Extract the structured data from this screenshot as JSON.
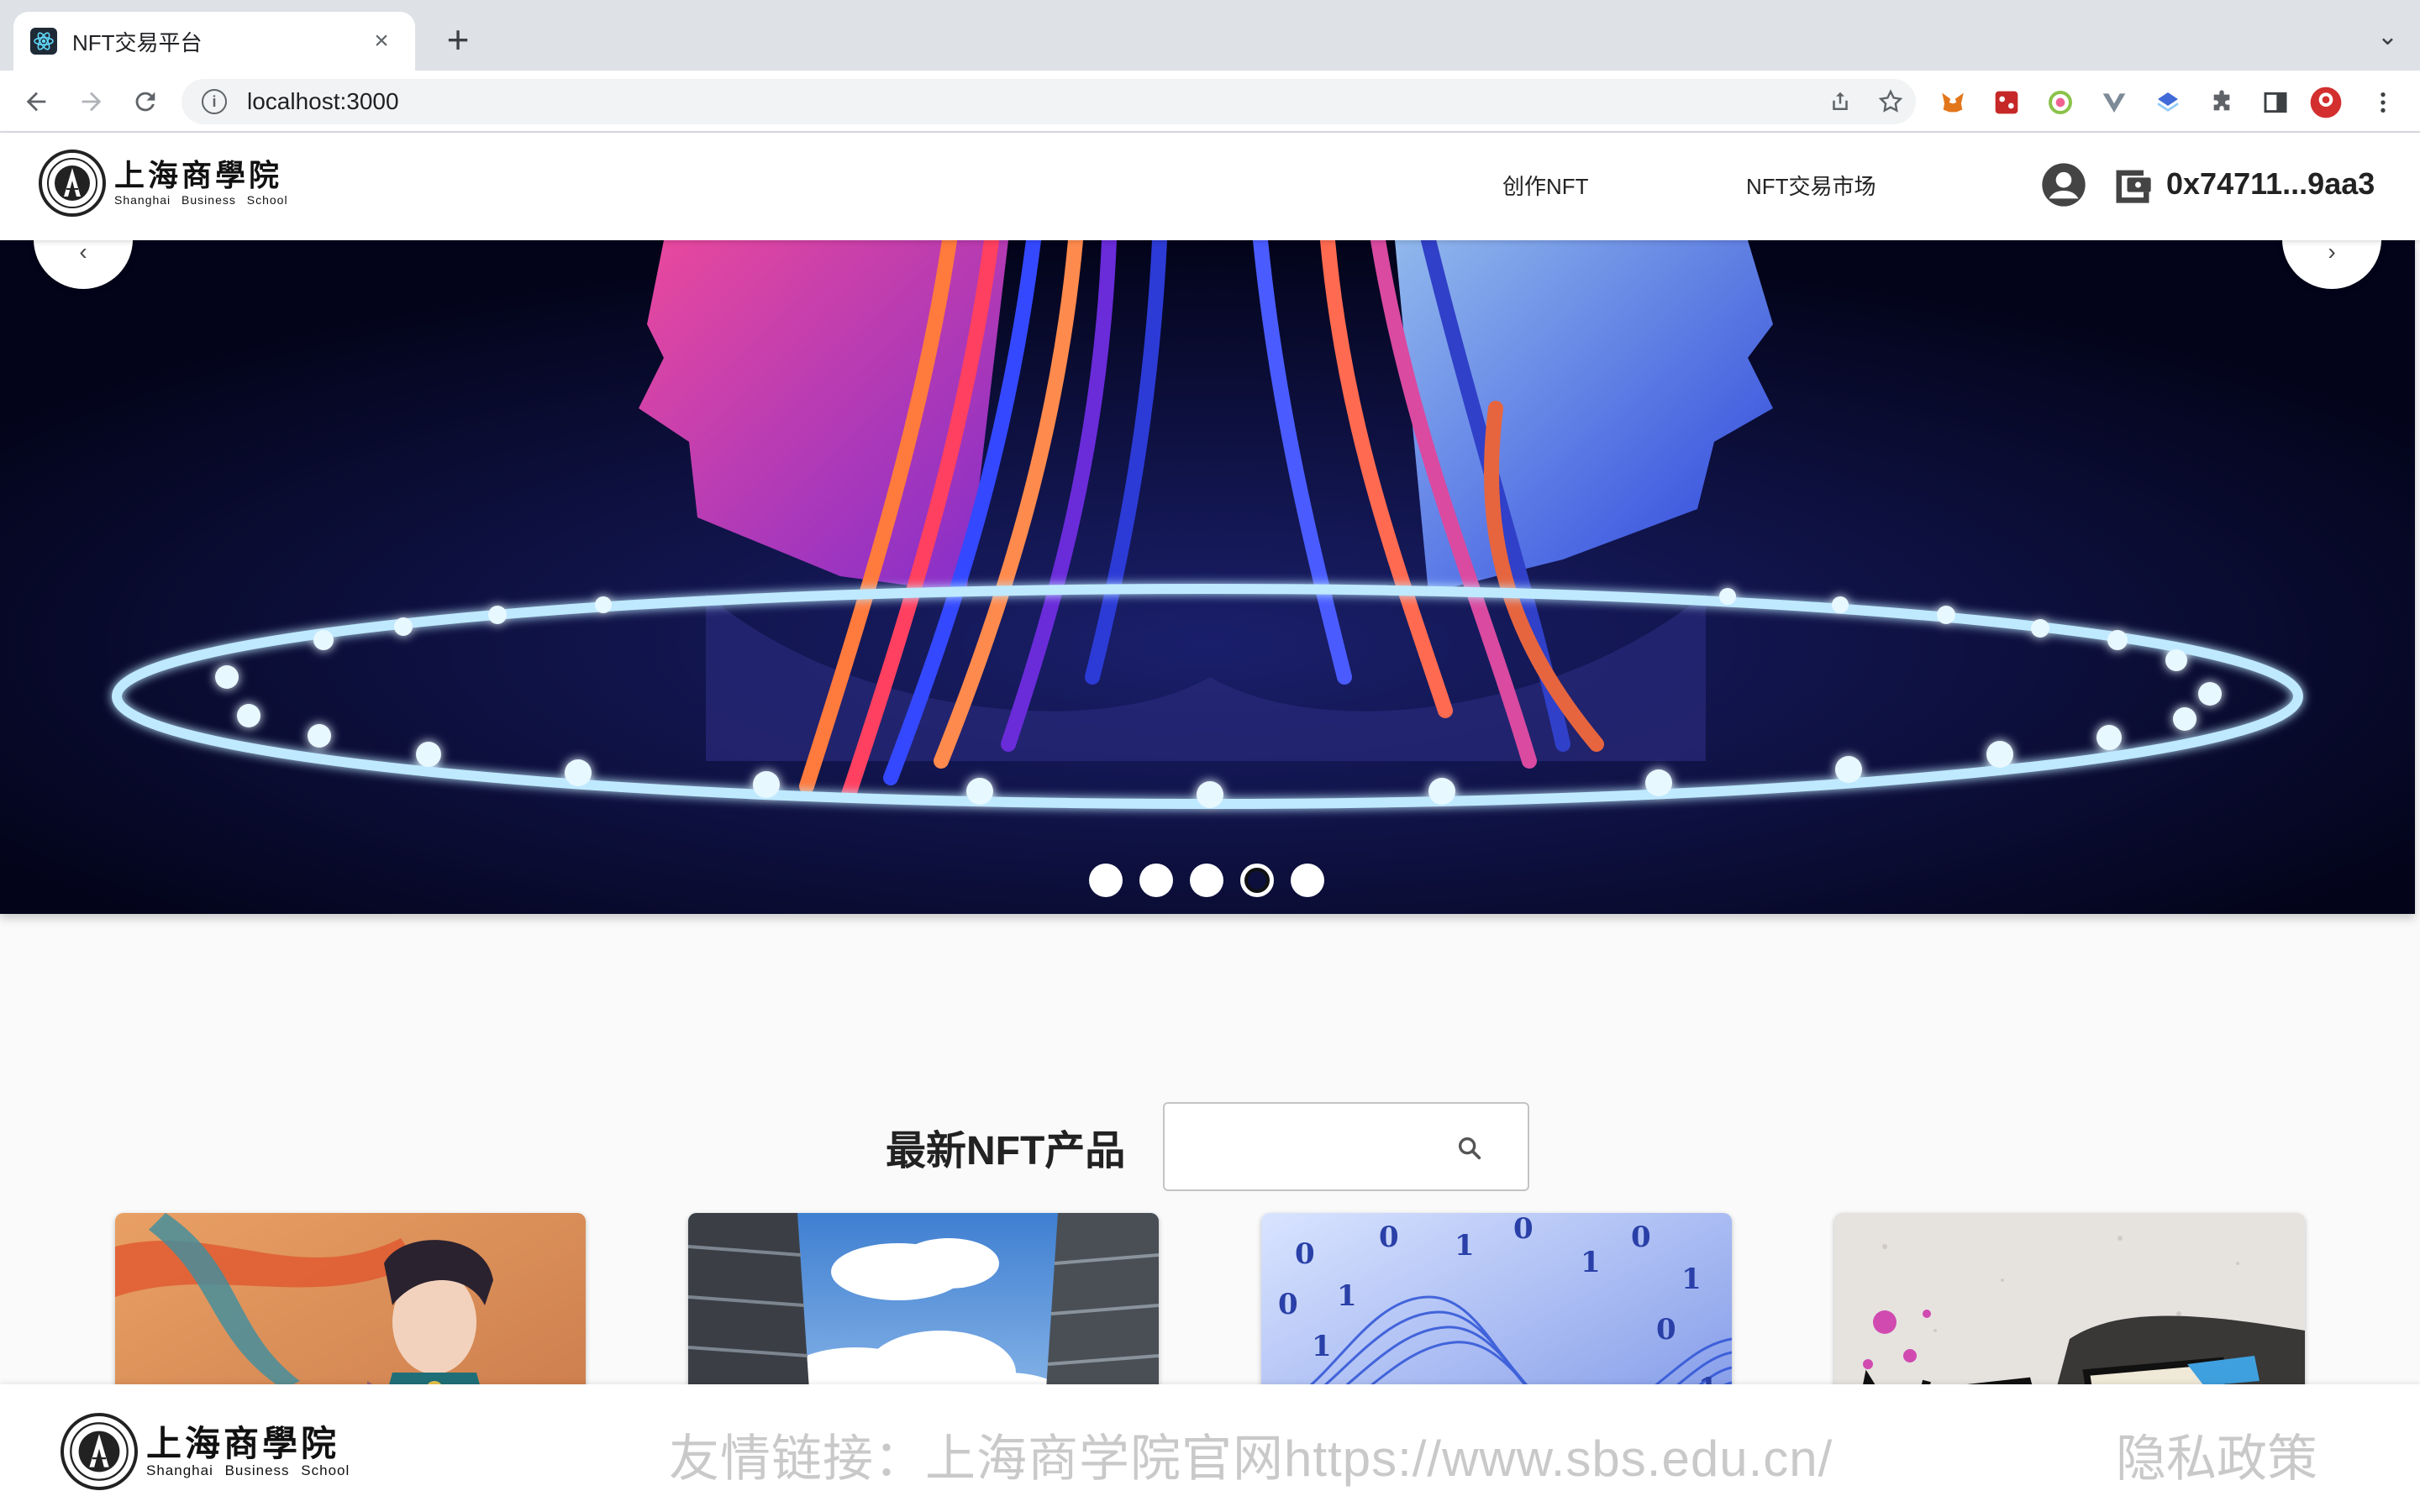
{
  "browser": {
    "tab_title": "NFT交易平台",
    "tab_close": "×",
    "new_tab": "+",
    "tab_search": "⌄",
    "url": "localhost:3000"
  },
  "header": {
    "logo_cn": "上海商學院",
    "logo_en": "Shanghai  Business  School",
    "nav": [
      "创作NFT",
      "NFT交易市场"
    ],
    "wallet_address": "0x74711...9aa3"
  },
  "carousel": {
    "slide_count": 5,
    "active_index": 3,
    "prev_label": "‹",
    "next_label": "›"
  },
  "main": {
    "section_title": "最新NFT产品",
    "search_placeholder": ""
  },
  "cards": [
    {
      "name": "card-1",
      "theme": "dunhuang-dancer"
    },
    {
      "name": "card-2",
      "theme": "sky-buildings"
    },
    {
      "name": "card-3",
      "theme": "binary-waves"
    },
    {
      "name": "card-4",
      "theme": "graffiti-nft"
    }
  ],
  "footer": {
    "logo_cn": "上海商學院",
    "logo_en": "Shanghai  Business  School",
    "links_text": "友情链接：上海商学院官网https://www.sbs.edu.cn/",
    "privacy": "隐私政策"
  },
  "colors": {
    "brand_dark": "#222222",
    "footer_text": "#c9c9c9",
    "carousel_bg": "#050723",
    "neon_ring": "#bfe9ff"
  }
}
